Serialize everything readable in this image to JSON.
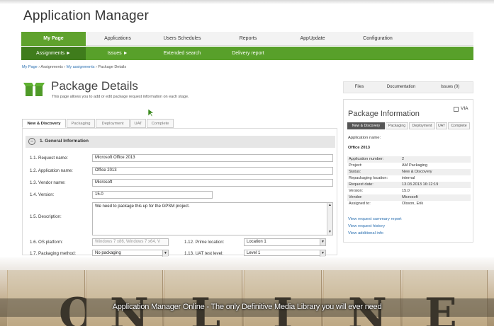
{
  "app": {
    "title": "Application Manager"
  },
  "topnav": {
    "items": [
      "My Page",
      "Applications",
      "Users Schedules",
      "Reports",
      "AppUpdate",
      "Configuration"
    ]
  },
  "subnav": {
    "items": [
      "Assignments ►",
      "Issues ►",
      "Extended search",
      "Delivery report"
    ]
  },
  "breadcrumb": {
    "items": [
      "My Page",
      "Assignments",
      "My assignments",
      "Package Details"
    ],
    "separator": "›"
  },
  "page": {
    "title": "Package Details",
    "description": "This page allows you to add or edit package request information on each stage."
  },
  "side_tabs": [
    "Files",
    "Documentation",
    "Issues (0)"
  ],
  "stage_tabs": [
    "New & Discovery",
    "Packaging",
    "Deployment",
    "UAT",
    "Complete"
  ],
  "section": {
    "title": "1. General Information",
    "toggle": "−"
  },
  "form": {
    "request_name": {
      "label": "1.1. Request name:",
      "value": "Microsoft Office 2013"
    },
    "application_name": {
      "label": "1.2. Application name:",
      "value": "Office 2013"
    },
    "vendor_name": {
      "label": "1.3. Vendor name:",
      "value": "Microsoft"
    },
    "version": {
      "label": "1.4. Version:",
      "value": "15.0"
    },
    "description": {
      "label": "1.5. Description:",
      "value": "We need to package this up for the GPSM project."
    },
    "os_platform": {
      "label": "1.6. OS platform:",
      "value": "Windows 7 x86, Windows 7 x64, V"
    },
    "prime_location": {
      "label": "1.12. Prime location:",
      "value": "Location 1"
    },
    "packaging_method": {
      "label": "1.7. Packaging method:",
      "value": "No packaging"
    },
    "uat_test_level": {
      "label": "1.13. UAT test level:",
      "value": "Level 1"
    }
  },
  "info": {
    "title": "Package Information",
    "via_label": "VIA",
    "tabs": [
      "New & Discovery",
      "Packaging",
      "Deployment",
      "UAT",
      "Complete"
    ],
    "application_name_label": "Application name:",
    "application_name": "Office 2013",
    "rows": [
      {
        "k": "Application number:",
        "v": "2"
      },
      {
        "k": "Project:",
        "v": "AM Packaging"
      },
      {
        "k": "Status:",
        "v": "New & Discovery"
      },
      {
        "k": "Repackaging location:",
        "v": "internal"
      },
      {
        "k": "Request date:",
        "v": "13.03.2013 16:12:19"
      },
      {
        "k": "Version:",
        "v": "15.0"
      },
      {
        "k": "Vendor:",
        "v": "Microsoft"
      },
      {
        "k": "Assigned to:",
        "v": "Olsson, Erik"
      }
    ],
    "links": [
      "View request summary report",
      "View request history",
      "View additional info"
    ]
  },
  "banner": {
    "caption": "Application Manager Online - The only Definitive Media Library you will ever need",
    "letters": [
      "O",
      "N",
      "L",
      "I",
      "N",
      "E"
    ]
  },
  "colors": {
    "nav_green": "#5fa22d",
    "nav_dark_green": "#3f7c1c",
    "link_blue": "#2a6fb0"
  }
}
